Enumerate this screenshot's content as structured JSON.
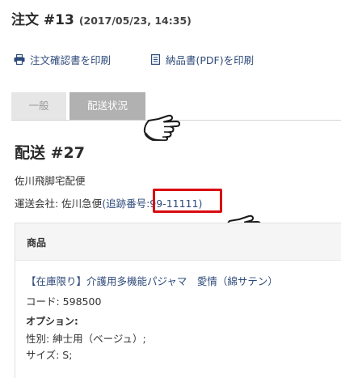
{
  "order": {
    "title": "注文 #13",
    "datetime": "(2017/05/23, 14:35)"
  },
  "print_links": {
    "confirmation": "注文確認書を印刷",
    "invoice": "納品書(PDF)を印刷"
  },
  "tabs": [
    {
      "label": "一般",
      "active": false
    },
    {
      "label": "配送状況",
      "active": true
    }
  ],
  "shipment": {
    "title": "配送 #27",
    "carrier": "佐川飛脚宅配便",
    "company_label": "運送会社: 佐川急便",
    "tracking": "(追跡番号:99-11111)"
  },
  "items": {
    "header": "商品",
    "product_name": "【在庫限り】介護用多機能パジャマ　愛情（綿サテン）",
    "code": "コード: 598500",
    "options_label": "オプション:",
    "options": [
      "性別: 紳士用（ベージュ）;",
      "サイズ: S;"
    ]
  },
  "colors": {
    "link": "#2e4a7a",
    "highlight": "#d90b12",
    "tab_active": "#b1b1b1",
    "tab_inactive": "#e6e6e6"
  },
  "icons": [
    "printer-icon",
    "document-icon",
    "pointing-hand-icon"
  ]
}
